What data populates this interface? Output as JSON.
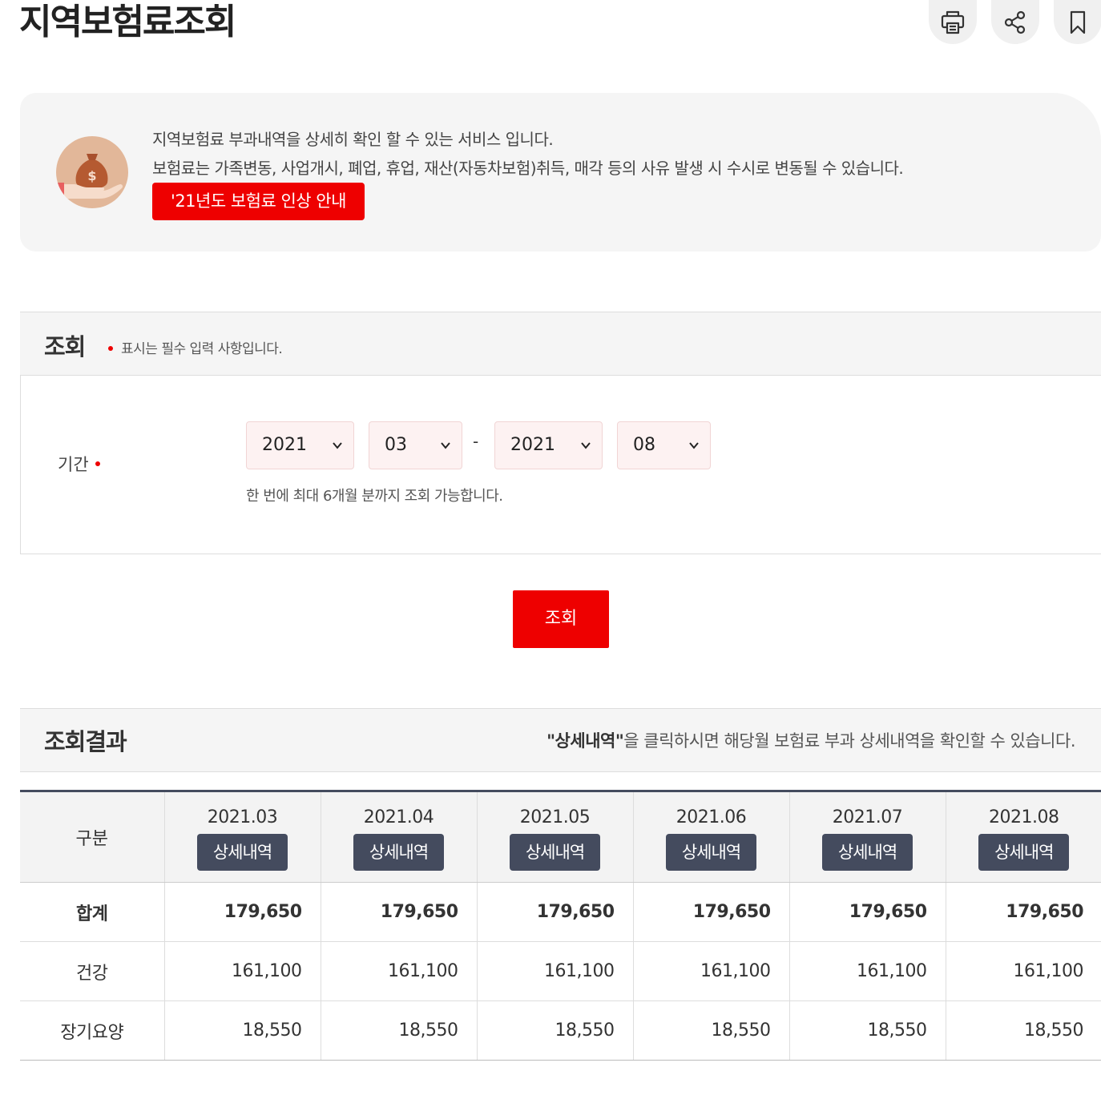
{
  "page": {
    "title": "지역보험료조회",
    "tools": {
      "print_icon": "printer-icon",
      "share_icon": "share-icon",
      "bookmark_icon": "bookmark-icon"
    }
  },
  "intro": {
    "icon": "money-bag-hand-icon",
    "line1": "지역보험료 부과내역을 상세히 확인 할 수 있는 서비스 입니다.",
    "line2": "보험료는 가족변동, 사업개시, 폐업, 휴업, 재산(자동차보험)취득, 매각 등의 사유 발생 시 수시로 변동될 수 있습니다.",
    "notice_button": "'21년도 보험료 인상 안내"
  },
  "search": {
    "title": "조회",
    "required_note": "표시는 필수 입력 사항입니다.",
    "period_label": "기간",
    "start_year": "2021",
    "start_month": "03",
    "separator": "-",
    "end_year": "2021",
    "end_month": "08",
    "help": "한 번에 최대 6개월 분까지 조회 가능합니다.",
    "submit": "조회"
  },
  "result": {
    "title": "조회결과",
    "note_bold": "\"상세내역\"",
    "note_rest": "을 클릭하시면 해당월 보험료 부과 상세내역을 확인할 수 있습니다.",
    "columns_header": "구분",
    "detail_label": "상세내역",
    "months": [
      "2021.03",
      "2021.04",
      "2021.05",
      "2021.06",
      "2021.07",
      "2021.08"
    ],
    "rows": [
      {
        "label": "합계",
        "values": [
          "179,650",
          "179,650",
          "179,650",
          "179,650",
          "179,650",
          "179,650"
        ]
      },
      {
        "label": "건강",
        "values": [
          "161,100",
          "161,100",
          "161,100",
          "161,100",
          "161,100",
          "161,100"
        ]
      },
      {
        "label": "장기요양",
        "values": [
          "18,550",
          "18,550",
          "18,550",
          "18,550",
          "18,550",
          "18,550"
        ]
      }
    ]
  },
  "colors": {
    "accent_red": "#ee0000",
    "dark_navy": "#444b5e",
    "panel_gray": "#f5f5f5"
  }
}
